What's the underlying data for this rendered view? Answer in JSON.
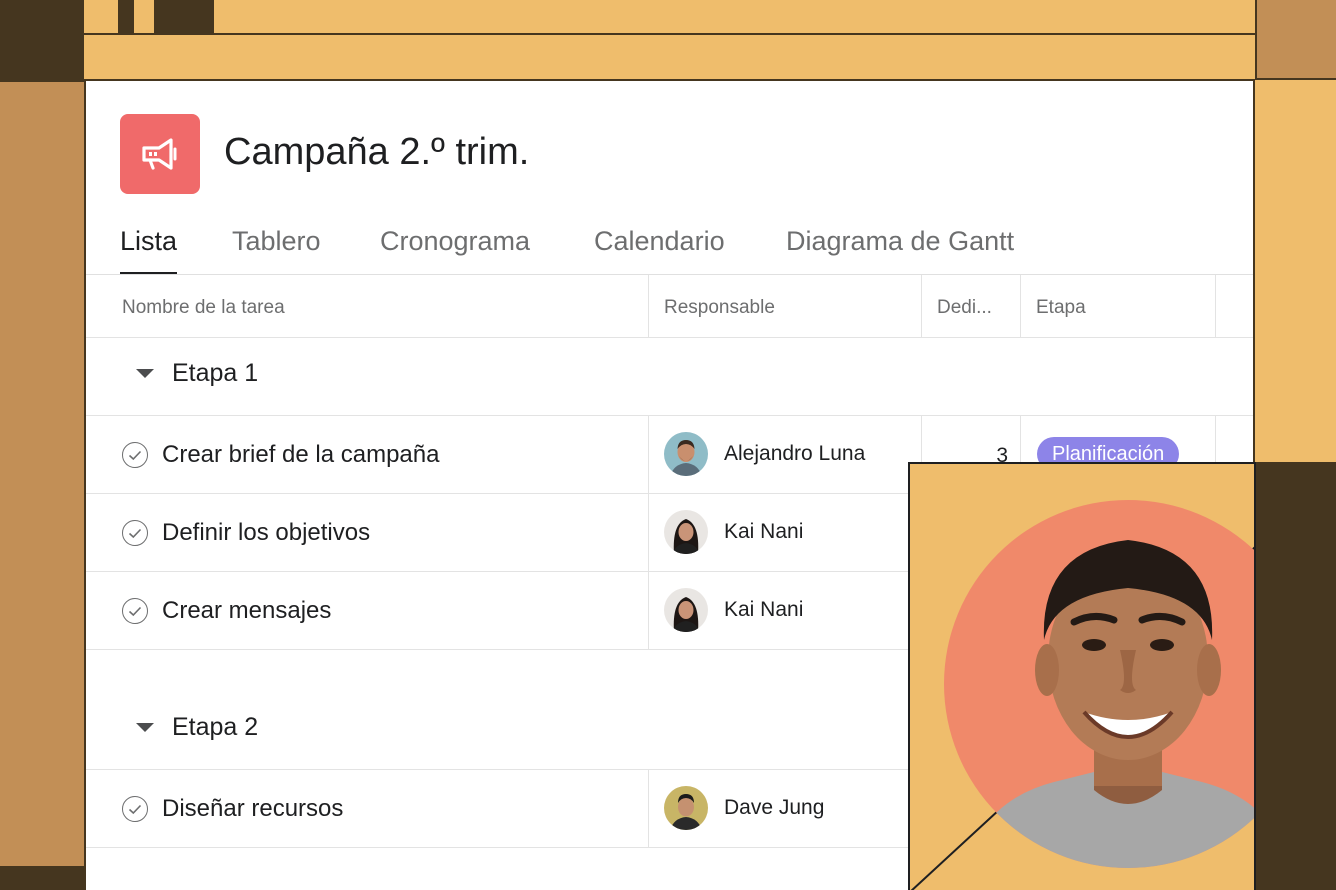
{
  "project": {
    "title": "Campaña 2.º trim.",
    "icon": "megaphone-icon",
    "icon_color": "#f06a6a"
  },
  "tabs": [
    {
      "label": "Lista",
      "active": true
    },
    {
      "label": "Tablero",
      "active": false
    },
    {
      "label": "Cronograma",
      "active": false
    },
    {
      "label": "Calendario",
      "active": false
    },
    {
      "label": "Diagrama de Gantt",
      "active": false
    }
  ],
  "columns": [
    "Nombre de la tarea",
    "Responsable",
    "Dedi...",
    "Etapa"
  ],
  "sections": [
    {
      "label": "Etapa 1",
      "tasks": [
        {
          "name": "Crear brief de la campaña",
          "assignee": "Alejandro Luna",
          "effort": "3",
          "stage": "Planificación"
        },
        {
          "name": "Definir los objetivos",
          "assignee": "Kai Nani"
        },
        {
          "name": "Crear mensajes",
          "assignee": "Kai Nani"
        }
      ]
    },
    {
      "label": "Etapa 2",
      "tasks": [
        {
          "name": "Diseñar recursos",
          "assignee": "Dave Jung"
        }
      ]
    }
  ],
  "colors": {
    "background": "#efbd6c",
    "dark_accent": "#45361f",
    "stage_pill": "#8d84e8",
    "portrait_bg": "#f0896a"
  }
}
